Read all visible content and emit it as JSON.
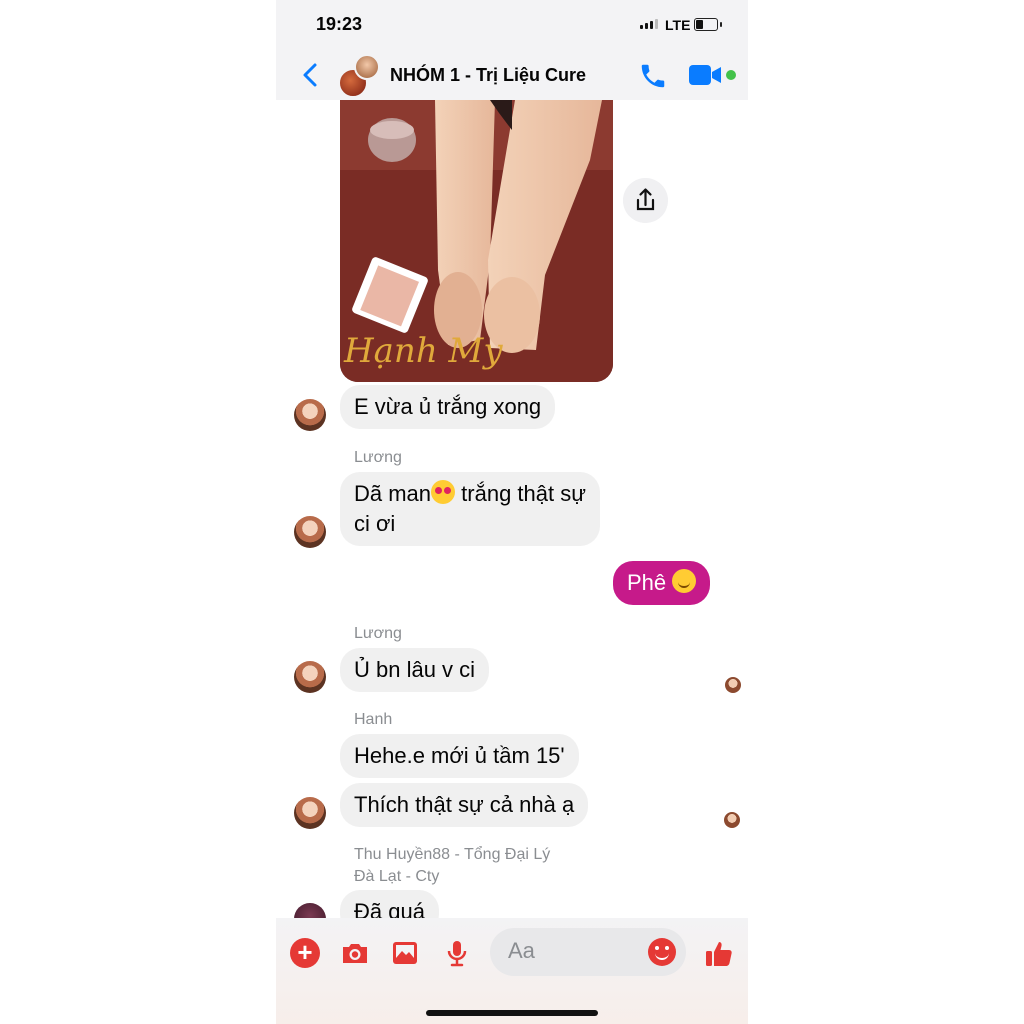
{
  "status_bar": {
    "time": "19:23",
    "network": "LTE"
  },
  "header": {
    "title": "NHÓM 1 - Trị Liệu Cure",
    "icons": {
      "back": "chevron-left-icon",
      "call": "phone-icon",
      "video": "video-camera-icon"
    },
    "accent_color": "#0a7cff"
  },
  "photo": {
    "watermark": "Hạnh My"
  },
  "messages": [
    {
      "side": "left",
      "text": "E vừa ủ trắng xong"
    },
    {
      "side": "left",
      "sender": "Lương",
      "text_before_emoji": "Dã man",
      "emoji": "heart-eyes",
      "text_after_emoji": " trắng thật sự",
      "text_line2": "ci ơi"
    },
    {
      "side": "right",
      "text": "Phê",
      "emoji": "smiling-face",
      "bubble_color": "#c61a8a"
    },
    {
      "side": "left",
      "sender": "Lương",
      "text": "Ủ bn lâu v ci"
    },
    {
      "side": "left",
      "sender": "Hanh",
      "text": "Hehe.e mới ủ tầm 15'"
    },
    {
      "side": "left",
      "text": "Thích thật sự cả nhà ạ"
    },
    {
      "side": "left",
      "sender_line1": "Thu Huyền88 - Tổng Đại Lý",
      "sender_line2": "Đà Lạt - Cty",
      "text": "Đã quá"
    }
  ],
  "composer": {
    "placeholder": "Aa",
    "icons": [
      "plus-icon",
      "camera-icon",
      "gallery-icon",
      "microphone-icon",
      "emoji-icon",
      "thumbs-up-icon"
    ],
    "accent_color": "#e53935"
  }
}
